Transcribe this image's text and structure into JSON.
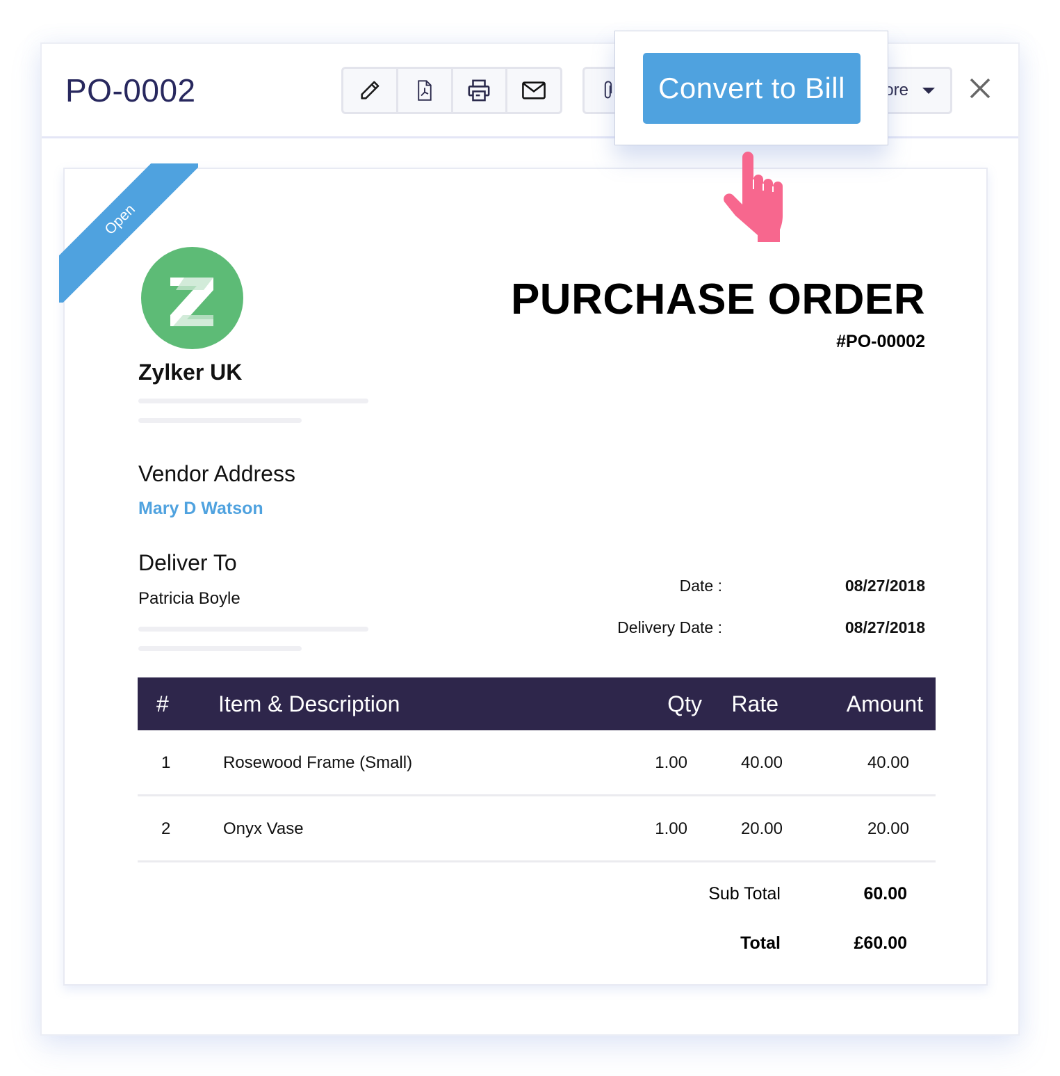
{
  "header": {
    "title": "PO-0002",
    "toolbar": [
      {
        "icon": "pencil-icon",
        "label": "Edit"
      },
      {
        "icon": "pdf-icon",
        "label": "PDF"
      },
      {
        "icon": "printer-icon",
        "label": "Print"
      },
      {
        "icon": "mail-icon",
        "label": "Email"
      }
    ],
    "attach_icon": "paperclip-icon",
    "more_label": "ore",
    "close_icon": "close-icon"
  },
  "popover": {
    "convert_label": "Convert to Bill"
  },
  "cursor": "pointer-hand-icon",
  "document": {
    "status_ribbon": "Open",
    "company_logo_letter": "Z",
    "company_name": "Zylker UK",
    "title": "PURCHASE ORDER",
    "number": "#PO-00002",
    "vendor_label": "Vendor Address",
    "vendor_name": "Mary D Watson",
    "deliver_label": "Deliver To",
    "deliver_name": "Patricia Boyle",
    "meta": [
      {
        "label": "Date :",
        "value": "08/27/2018"
      },
      {
        "label": "Delivery Date :",
        "value": "08/27/2018"
      }
    ],
    "table": {
      "headers": {
        "num": "#",
        "item": "Item & Description",
        "qty": "Qty",
        "rate": "Rate",
        "amount": "Amount"
      },
      "rows": [
        {
          "num": "1",
          "item": "Rosewood Frame (Small)",
          "qty": "1.00",
          "rate": "40.00",
          "amount": "40.00"
        },
        {
          "num": "2",
          "item": "Onyx Vase",
          "qty": "1.00",
          "rate": "20.00",
          "amount": "20.00"
        }
      ]
    },
    "totals": [
      {
        "label": "Sub Total",
        "value": "60.00"
      },
      {
        "label": "Total",
        "value": "£60.00"
      }
    ]
  },
  "colors": {
    "accent": "#4fa2df",
    "title_navy": "#28285e",
    "table_header": "#2e264b",
    "logo_green": "#5dbb76",
    "hand_pink": "#f7678e"
  }
}
